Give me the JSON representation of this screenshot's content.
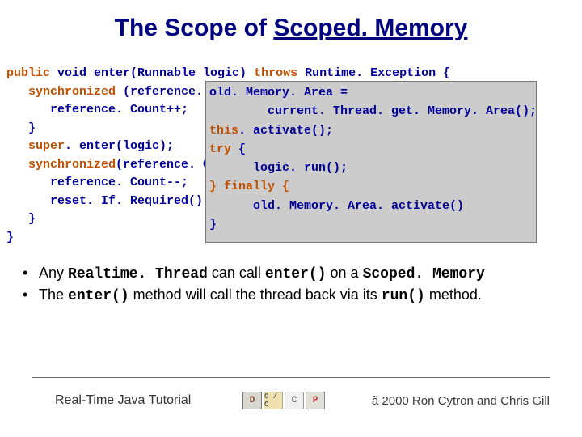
{
  "title": {
    "prefix": "The Scope of ",
    "emph": "Scoped. Memory"
  },
  "codeBack": {
    "l1a": "public",
    "l1b": " void enter(Runnable logic) ",
    "l1c": "throws",
    "l1d": " Runtime. Exception {",
    "l2a": "   synchronized",
    "l2b": " (reference. C",
    "l3": "      reference. Count++;",
    "l4": "   }",
    "l5a": "   super",
    "l5b": ". enter(logic);",
    "l6a": "   synchronized",
    "l6b": "(reference. Co",
    "l7": "      reference. Count--;",
    "l8": "      reset. If. Required();",
    "l9": "   }",
    "l10": "}"
  },
  "codeBox": {
    "l1": "old. Memory. Area =",
    "l2": "        current. Thread. get. Memory. Area();",
    "l3k": "this",
    "l3r": ". activate();",
    "l4k": "try",
    "l4r": " {",
    "l5": "      logic. run();",
    "l6k": "} finally {",
    "l7": "      old. Memory. Area. activate()",
    "l8": "}"
  },
  "bullets": {
    "b1": {
      "pre": "Any ",
      "m1": "Realtime. Thread",
      "mid": " can call ",
      "m2": "enter()",
      "mid2": " on a ",
      "m3": "Scoped. Memory"
    },
    "b2": {
      "pre": "The ",
      "m1": "enter()",
      "mid": " method will call the thread back via its ",
      "m2": "run()",
      "post": " method."
    }
  },
  "footer": {
    "leftPre": "Real-Time ",
    "leftU": "Java ",
    "leftPost": "Tutorial",
    "logos": [
      "D",
      "O / C",
      "C",
      "P"
    ],
    "right": "ã 2000 Ron Cytron and Chris Gill"
  }
}
